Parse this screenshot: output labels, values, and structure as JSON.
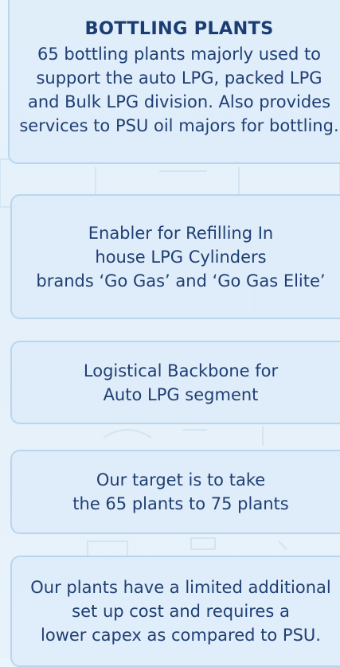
{
  "cards": [
    {
      "title": "BOTTLING PLANTS",
      "body": "65 bottling plants majorly used to\nsupport the auto LPG, packed LPG\nand Bulk LPG division. Also provides\nservices to PSU oil majors for bottling."
    },
    {
      "body": "Enabler for Refilling In\nhouse LPG Cylinders\nbrands ‘Go Gas’ and ‘Go Gas Elite’"
    },
    {
      "body": "Logistical Backbone for\nAuto LPG segment"
    },
    {
      "body": "Our target is to take\nthe 65 plants to 75 plants"
    },
    {
      "body": "Our plants have a limited additional\nset up cost and requires a\nlower capex as compared to PSU."
    }
  ]
}
